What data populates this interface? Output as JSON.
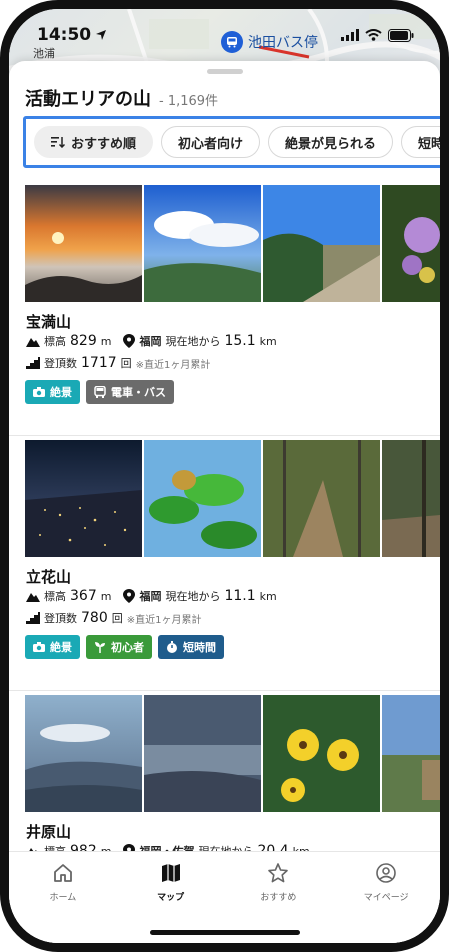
{
  "status_bar": {
    "time": "14:50",
    "map_place": "池浦",
    "bus_stop": "池田バス停"
  },
  "sheet": {
    "title": "活動エリアの山",
    "count": "- 1,169件"
  },
  "filters": [
    {
      "label": "おすすめ順",
      "icon": "sort-icon",
      "active": true
    },
    {
      "label": "初心者向け",
      "active": false
    },
    {
      "label": "絶景が見られる",
      "active": false
    },
    {
      "label": "短時",
      "active": false
    }
  ],
  "mountains": [
    {
      "name": "宝満山",
      "elev_label": "標高",
      "elevation": "829",
      "elev_unit": "m",
      "prefecture": "福岡",
      "dist_label": "現在地から",
      "distance": "15.1",
      "dist_unit": "km",
      "climbs_label": "登頂数",
      "climbs": "1717",
      "climbs_unit": "回",
      "climbs_note": "※直近1ヶ月累計",
      "tags": [
        {
          "label": "絶景",
          "icon": "camera-icon",
          "color": "#1aa9b5"
        },
        {
          "label": "電車・バス",
          "icon": "bus-icon",
          "color": "#6b6b6b"
        }
      ]
    },
    {
      "name": "立花山",
      "elev_label": "標高",
      "elevation": "367",
      "elev_unit": "m",
      "prefecture": "福岡",
      "dist_label": "現在地から",
      "distance": "11.1",
      "dist_unit": "km",
      "climbs_label": "登頂数",
      "climbs": "780",
      "climbs_unit": "回",
      "climbs_note": "※直近1ヶ月累計",
      "tags": [
        {
          "label": "絶景",
          "icon": "camera-icon",
          "color": "#1aa9b5"
        },
        {
          "label": "初心者",
          "icon": "sprout-icon",
          "color": "#3a9a3a"
        },
        {
          "label": "短時間",
          "icon": "stopwatch-icon",
          "color": "#1f5c8c"
        }
      ]
    },
    {
      "name": "井原山",
      "elev_label": "標高",
      "elevation": "982",
      "elev_unit": "m",
      "prefecture": "福岡・佐賀",
      "dist_label": "現在地から",
      "distance": "20.4",
      "dist_unit": "km"
    }
  ],
  "tabbar": [
    {
      "label": "ホーム",
      "icon": "home-icon",
      "active": false
    },
    {
      "label": "マップ",
      "icon": "map-icon",
      "active": true
    },
    {
      "label": "おすすめ",
      "icon": "star-icon",
      "active": false
    },
    {
      "label": "マイページ",
      "icon": "user-icon",
      "active": false
    }
  ]
}
